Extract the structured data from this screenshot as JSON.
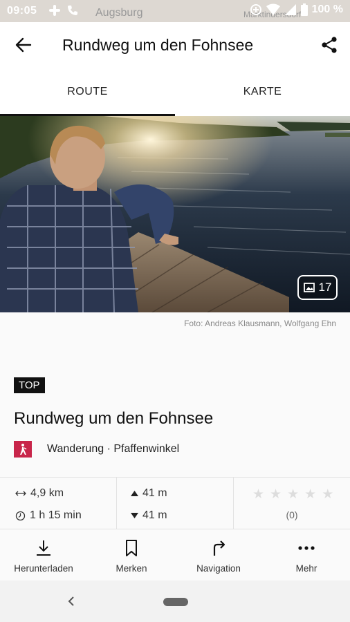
{
  "status_bar": {
    "time": "09:05",
    "battery": "100 %",
    "map_labels": [
      "Augsburg",
      "Marktindersdorf"
    ]
  },
  "app_bar": {
    "title": "Rundweg um den Fohnsee",
    "icons": {
      "back": "arrow-left-icon",
      "share": "share-icon"
    }
  },
  "tabs": [
    {
      "label": "ROUTE",
      "active": true
    },
    {
      "label": "KARTE",
      "active": false
    }
  ],
  "hero": {
    "photo_count": "17",
    "credit": "Foto: Andreas Klausmann, Wolfgang Ehn"
  },
  "route": {
    "badge": "TOP",
    "title": "Rundweg um den Fohnsee",
    "category": "Wanderung",
    "separator": "·",
    "region": "Pfaffenwinkel",
    "category_color": "#c8254a"
  },
  "stats": {
    "distance": "4,9 km",
    "duration": "1 h 15 min",
    "ascent": "41 m",
    "descent": "41 m",
    "rating_stars": 0,
    "rating_max": 5,
    "rating_count": "(0)"
  },
  "actions": [
    {
      "label": "Herunterladen",
      "icon": "download-icon"
    },
    {
      "label": "Merken",
      "icon": "bookmark-icon"
    },
    {
      "label": "Navigation",
      "icon": "turn-right-arrow-icon"
    },
    {
      "label": "Mehr",
      "icon": "more-dots-icon"
    }
  ]
}
